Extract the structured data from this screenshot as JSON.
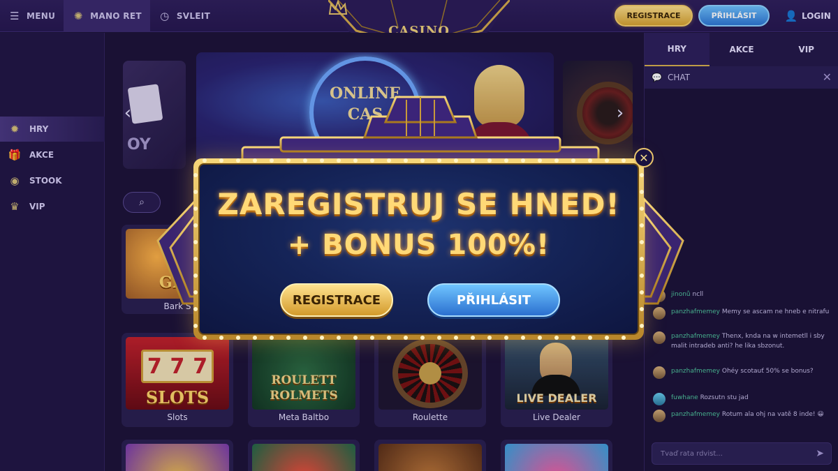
{
  "topbar": {
    "menu_label": "MENU",
    "casino_nav_label": "MANO RET",
    "history_label": "SVLEIT",
    "logo_text": "CASINO",
    "register_label": "REGISTRACE",
    "login_button_label": "PŘIHLÁSIT",
    "login_label": "LOGIN",
    "icons": {
      "menu": "hamburger-icon",
      "casino": "chip-icon",
      "history": "clock-icon",
      "user": "user-icon"
    }
  },
  "sidebar": {
    "items": [
      {
        "label": "HRY",
        "icon": "star-icon",
        "active": true
      },
      {
        "label": "AKCE",
        "icon": "gift-icon",
        "active": false
      },
      {
        "label": "STOOK",
        "icon": "coin-icon",
        "active": false
      },
      {
        "label": "VIP",
        "icon": "crown-icon",
        "active": false
      }
    ]
  },
  "main": {
    "banner": {
      "left_text": "OY",
      "center_line1": "ONLINE",
      "center_line2": "CAS"
    },
    "games": [
      {
        "title": "Bark S",
        "thumb_text": "GLU"
      },
      {
        "title": "Slots",
        "thumb_text": "SLOTS"
      },
      {
        "title": "Meta Baltbo",
        "thumb_text1": "ROULETT",
        "thumb_text2": "ROLMETS"
      },
      {
        "title": "Roulette",
        "thumb_text": ""
      },
      {
        "title": "Live Dealer",
        "thumb_text": "LIVE DEALER"
      }
    ]
  },
  "rightpanel": {
    "tabs": [
      {
        "label": "HRY",
        "active": true
      },
      {
        "label": "AKCE",
        "active": false
      },
      {
        "label": "VIP",
        "active": false
      }
    ],
    "chat_title": "CHAT",
    "messages": [
      {
        "user": "jinonů",
        "text": "ncll"
      },
      {
        "user": "panzhafmemey",
        "text": "Memy se ascam ne hneb e nitrafu"
      },
      {
        "user": "panzhafmemey",
        "text": "Thenx, knda na w intemetll i sby malit intradeb anti? he lika sbzonut."
      },
      {
        "user": "panzhafmemey",
        "text": "Ohéy scotauť 50% se bonus?"
      },
      {
        "user": "fuwhane",
        "text": "Rozsutn stu jad"
      },
      {
        "user": "panzhafmemey",
        "text": "Rotum ala ohj na vatě 8 inde! 😀"
      }
    ],
    "input_placeholder": "Tvaď rata rdvist..."
  },
  "modal": {
    "headline_line1": "ZAREGISTRUJ SE HNED!",
    "headline_line2": "+ BONUS 100%!",
    "register_label": "REGISTRACE",
    "login_label": "PŘIHLÁSIT",
    "colors": {
      "gold": "#f5d27a",
      "blue": "#3b8ee8",
      "panel": "#152458"
    }
  }
}
